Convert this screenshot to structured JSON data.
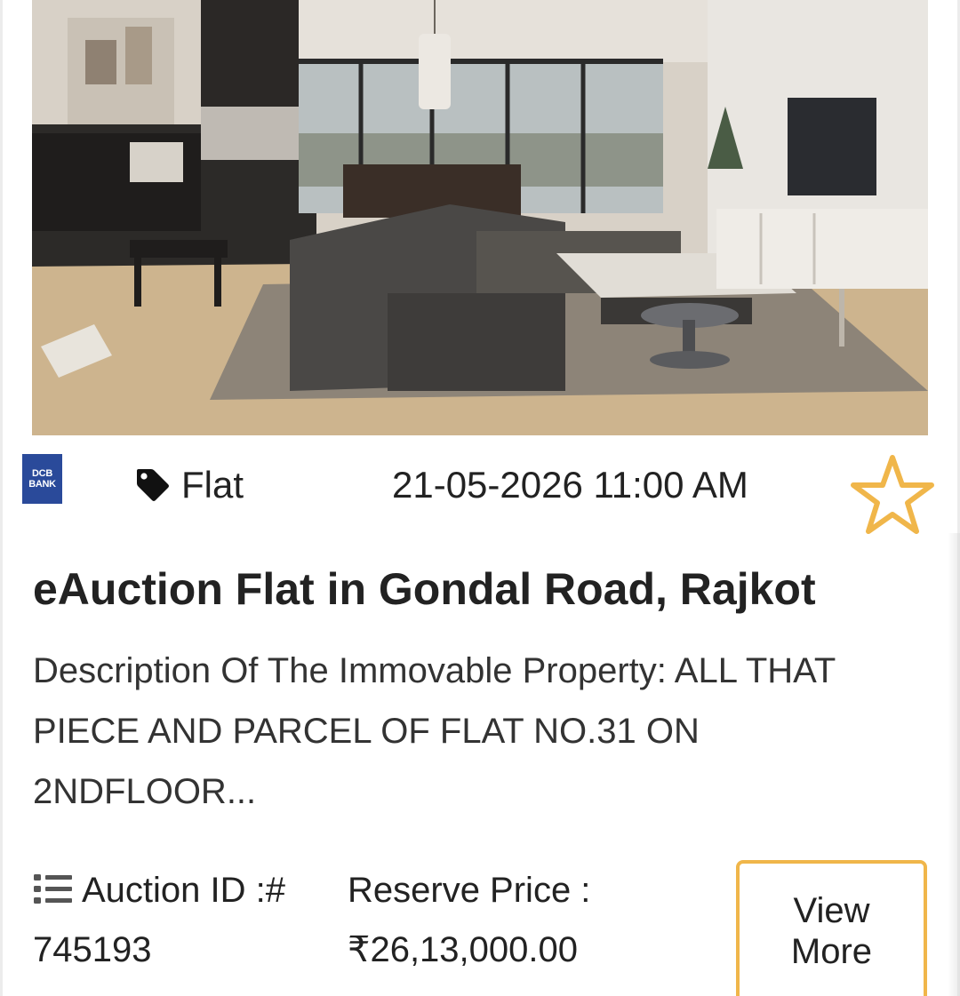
{
  "listing": {
    "photo_alt": "living-room-photo",
    "bank_logo": {
      "line1": "DCB",
      "line2": "BANK",
      "color": "#2a4a9a"
    },
    "property_type": "Flat",
    "auction_datetime": "21-05-2026 11:00 AM",
    "favorite_icon": "star-outline-icon",
    "accent_color": "#f0b64a",
    "title": "eAuction Flat in Gondal Road, Rajkot",
    "description": "Description Of The Immovable Property: ALL THAT PIECE AND PARCEL OF FLAT NO.31 ON 2NDFLOOR...",
    "auction_id_label": "Auction ID :#",
    "auction_id": "745193",
    "reserve_price_label": "Reserve Price :",
    "reserve_price": "₹26,13,000.00",
    "view_more_line1": "View",
    "view_more_line2": "More"
  }
}
